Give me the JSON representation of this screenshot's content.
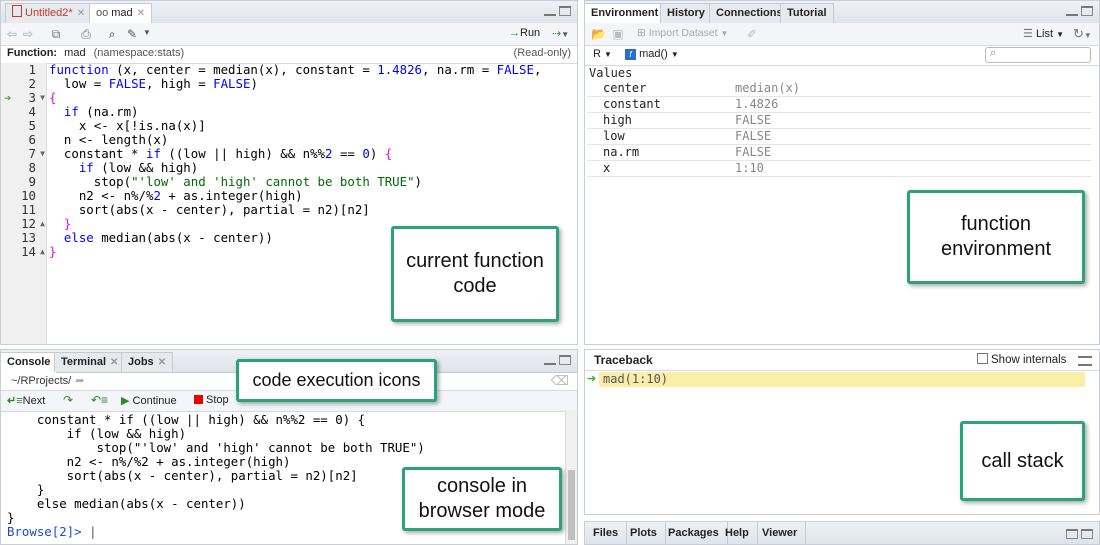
{
  "source_pane": {
    "tabs": [
      {
        "label": "Untitled2*",
        "closable": true
      },
      {
        "label": "mad",
        "closable": true
      }
    ],
    "run_label": "Run",
    "function_label": "Function:",
    "function_name": "mad",
    "namespace": "(namespace:stats)",
    "readonly": "(Read-only)",
    "line_numbers": [
      "1",
      "2",
      "3",
      "4",
      "5",
      "6",
      "7",
      "8",
      "9",
      "10",
      "11",
      "12",
      "13",
      "14"
    ],
    "current_line": 3
  },
  "console_pane": {
    "tabs": [
      "Console",
      "Terminal",
      "Jobs"
    ],
    "path": "~/RProjects/",
    "next_label": "Next",
    "continue_label": "Continue",
    "stop_label": "Stop",
    "prompt": "Browse[2]>"
  },
  "env_pane": {
    "tabs": [
      "Environment",
      "History",
      "Connections",
      "Tutorial"
    ],
    "import_label": "Import Dataset",
    "list_label": "List",
    "lang_label": "R",
    "scope_label": "mad()",
    "section_label": "Values",
    "rows": [
      {
        "name": "center",
        "value": "median(x)"
      },
      {
        "name": "constant",
        "value": "1.4826"
      },
      {
        "name": "high",
        "value": "FALSE"
      },
      {
        "name": "low",
        "value": "FALSE"
      },
      {
        "name": "na.rm",
        "value": "FALSE"
      },
      {
        "name": "x",
        "value": "1:10"
      }
    ]
  },
  "traceback_pane": {
    "title": "Traceback",
    "show_internals": "Show internals",
    "frames": [
      "mad(1:10)"
    ]
  },
  "files_pane": {
    "tabs": [
      "Files",
      "Plots",
      "Packages",
      "Help",
      "Viewer"
    ]
  },
  "annotations": {
    "code": "current function code",
    "env": "function environment",
    "icons": "code execution icons",
    "console": "console in browser mode",
    "stack": "call stack"
  },
  "colors": {
    "annotation_border": "#2aa37c",
    "keyword": "#0000ff",
    "string": "#036a07",
    "bracket": "#ff00ff",
    "traceback_highlight": "#fbeea8",
    "debug_arrow": "#3bab2a"
  }
}
